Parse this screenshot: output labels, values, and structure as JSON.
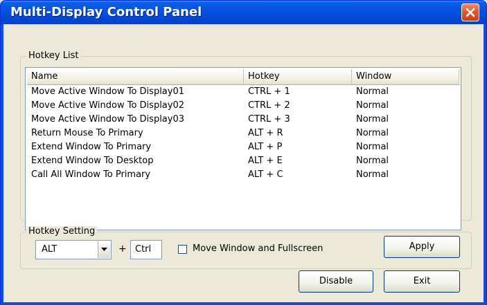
{
  "window": {
    "title": "Multi-Display Control Panel"
  },
  "hotkey_list": {
    "label": "Hotkey List",
    "columns": [
      "Name",
      "Hotkey",
      "Window"
    ],
    "rows": [
      {
        "name": "Move Active Window To Display01",
        "hotkey": "CTRL + 1",
        "window": "Normal"
      },
      {
        "name": "Move Active Window To Display02",
        "hotkey": "CTRL + 2",
        "window": "Normal"
      },
      {
        "name": "Move Active Window To Display03",
        "hotkey": "CTRL + 3",
        "window": "Normal"
      },
      {
        "name": "Return Mouse To Primary",
        "hotkey": "ALT + R",
        "window": "Normal"
      },
      {
        "name": "Extend Window To Primary",
        "hotkey": "ALT + P",
        "window": "Normal"
      },
      {
        "name": "Extend Window To Desktop",
        "hotkey": "ALT + E",
        "window": "Normal"
      },
      {
        "name": "Call All Window To Primary",
        "hotkey": "ALT + C",
        "window": "Normal"
      }
    ]
  },
  "hotkey_setting": {
    "label": "Hotkey Setting",
    "modifier_value": "ALT",
    "plus": "+",
    "key_value": "Ctrl",
    "checkbox_label": "Move Window and Fullscreen",
    "checkbox_checked": false,
    "apply_label": "Apply"
  },
  "footer": {
    "disable_label": "Disable",
    "exit_label": "Exit"
  },
  "icons": {
    "close": "close-icon",
    "dropdown": "chevron-down-icon"
  },
  "colors": {
    "titlebar": "#0553e1",
    "close_button": "#e05a2e",
    "dialog_bg": "#ece9d8"
  }
}
